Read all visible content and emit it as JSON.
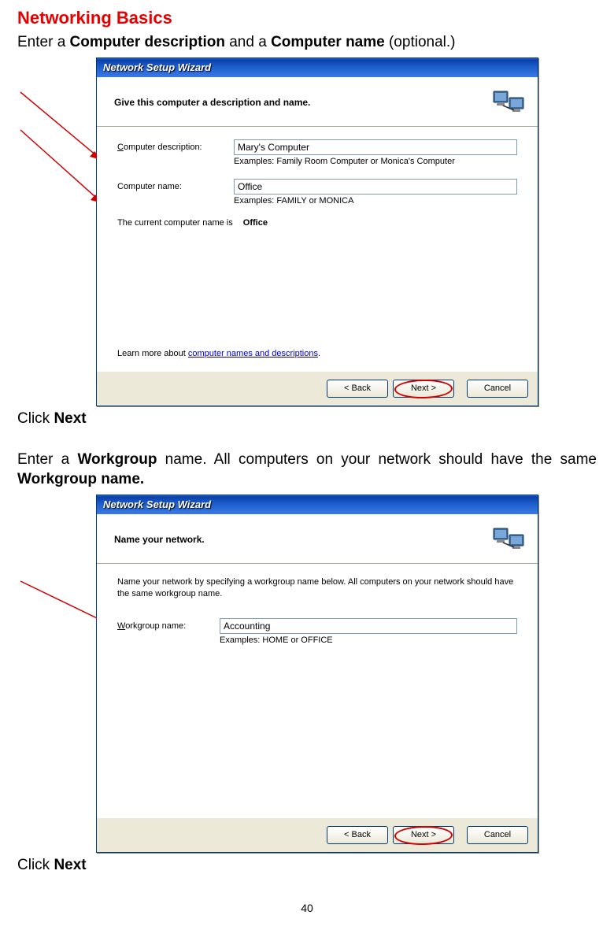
{
  "page": {
    "title": "Networking Basics",
    "number": "40"
  },
  "step1": {
    "intro_pre": "Enter a ",
    "intro_b1": "Computer description",
    "intro_mid": " and a ",
    "intro_b2": "Computer name",
    "intro_post": " (optional.)",
    "after": "Click ",
    "after_b": "Next"
  },
  "step2": {
    "intro_pre": "Enter a ",
    "intro_b1": "Workgroup",
    "intro_mid": " name.  All computers on your network should have the same ",
    "intro_b2": "Workgroup name.",
    "after": "Click ",
    "after_b": "Next"
  },
  "wizard1": {
    "title": "Network Setup Wizard",
    "header": "Give this computer a description and name.",
    "label_desc_pre": "C",
    "label_desc_rest": "omputer description:",
    "value_desc": "Mary's Computer",
    "examples_desc": "Examples: Family Room Computer or Monica's Computer",
    "label_name": "Computer name:",
    "value_name": "Office",
    "examples_name": "Examples: FAMILY or MONICA",
    "current_pre": "The current computer name is",
    "current_val": "Office",
    "learn_pre": "Learn more about ",
    "learn_link": "computer names and descriptions",
    "learn_post": ".",
    "btn_back": "< Back",
    "btn_next": "Next >",
    "btn_cancel": "Cancel"
  },
  "wizard2": {
    "title": "Network Setup Wizard",
    "header": "Name your network.",
    "body_text": "Name your network by specifying a workgroup name below. All computers on your network should have the same workgroup name.",
    "label_wg_pre": "W",
    "label_wg_rest": "orkgroup name:",
    "value_wg": "Accounting",
    "examples_wg": "Examples: HOME or OFFICE",
    "btn_back": "< Back",
    "btn_next": "Next >",
    "btn_cancel": "Cancel"
  }
}
